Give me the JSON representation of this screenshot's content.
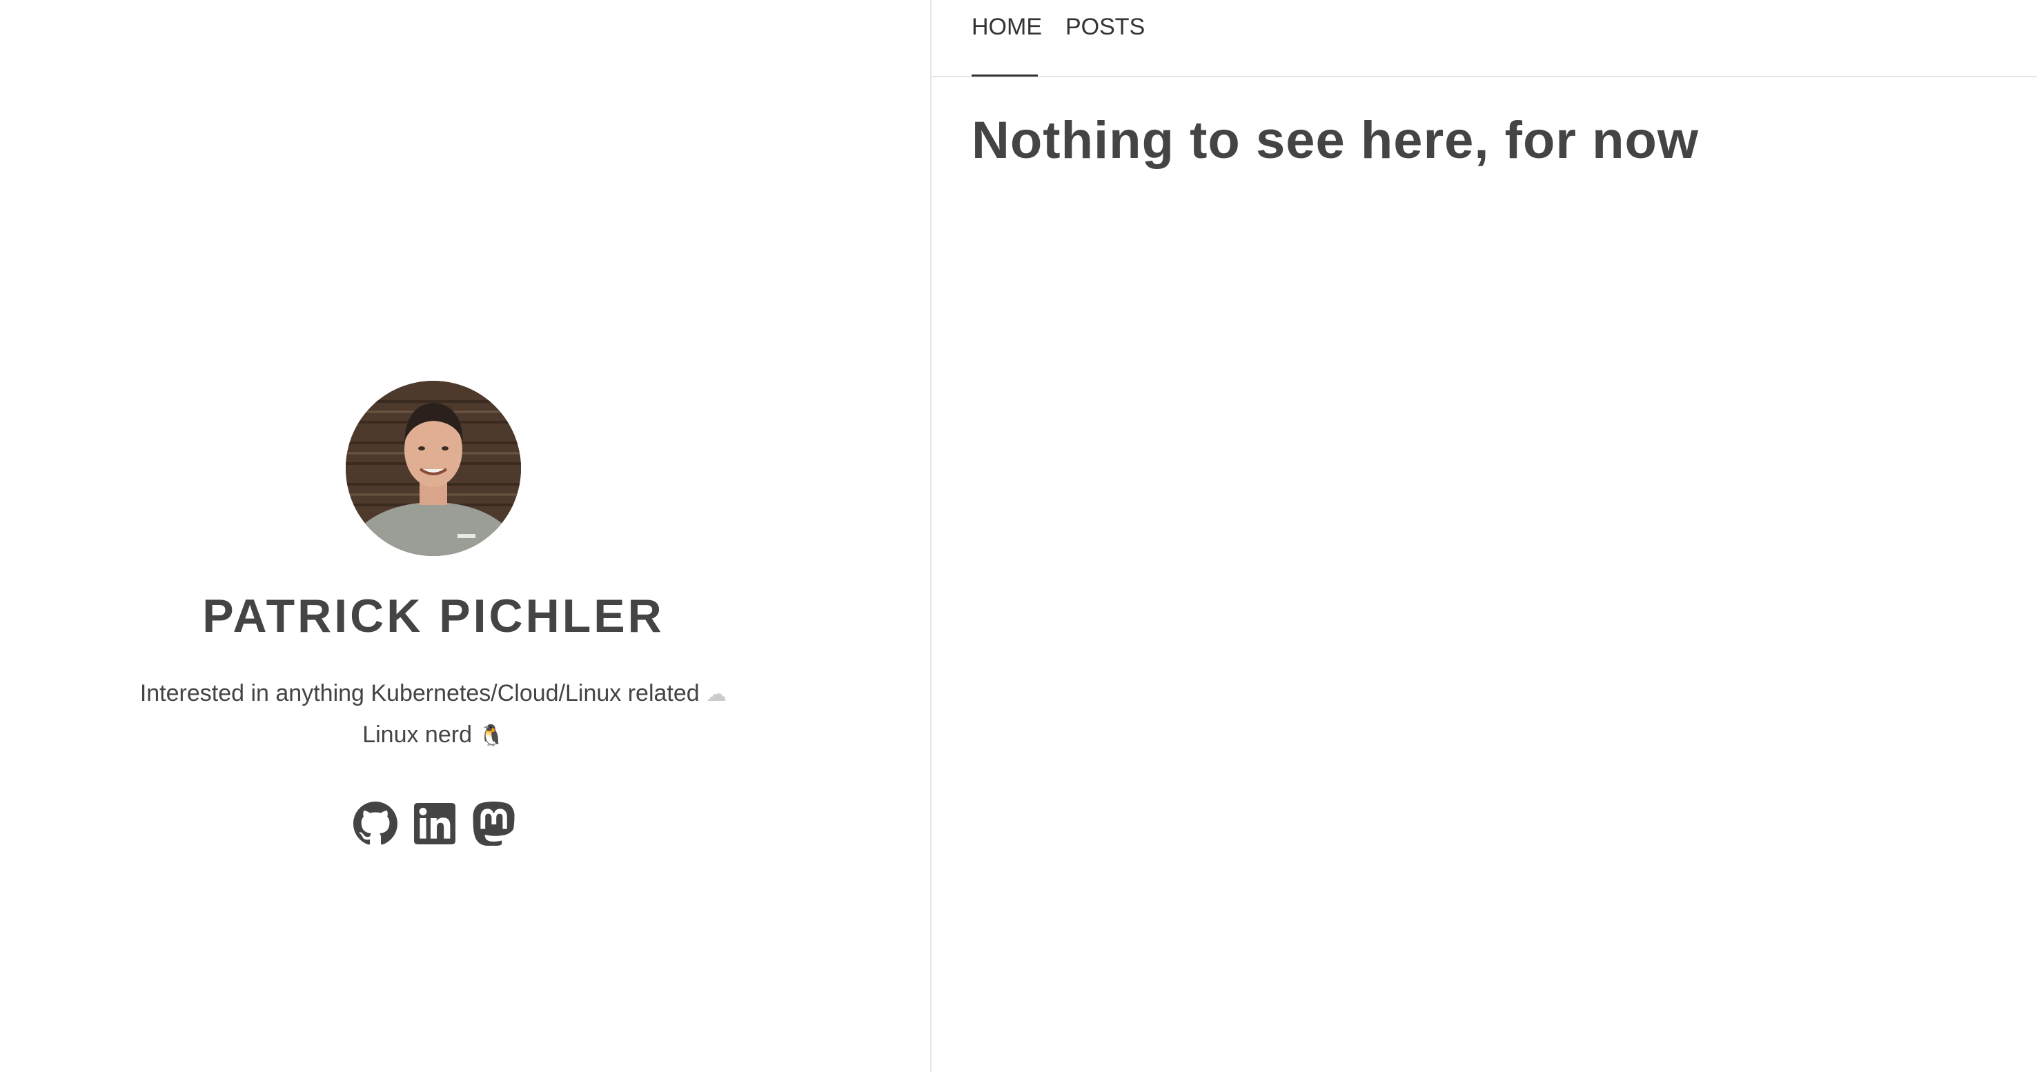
{
  "profile": {
    "name": "PATRICK PICHLER",
    "bio_line1_text": "Interested in anything Kubernetes/Cloud/Linux related",
    "bio_line1_emoji": "☁",
    "bio_line2_text": "Linux nerd",
    "bio_line2_emoji": "🐧",
    "avatar_alt": "Patrick Pichler",
    "socials": [
      {
        "icon": "github-icon"
      },
      {
        "icon": "linkedin-icon"
      },
      {
        "icon": "mastodon-icon"
      }
    ]
  },
  "nav": {
    "items": [
      {
        "label": "HOME",
        "active": true
      },
      {
        "label": "POSTS",
        "active": false
      }
    ]
  },
  "main": {
    "heading": "Nothing to see here, for now"
  },
  "colors": {
    "text": "#444444",
    "divider": "#e6e6e6",
    "icon": "#444444"
  }
}
